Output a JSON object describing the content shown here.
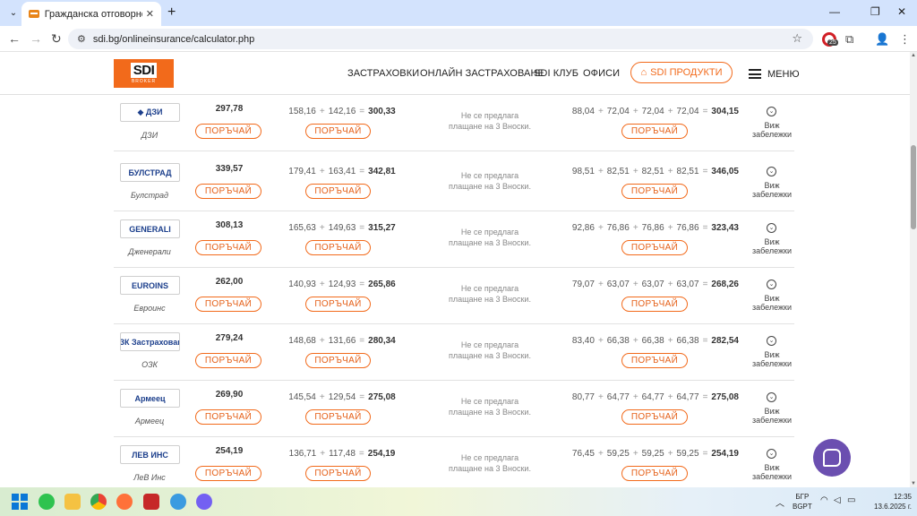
{
  "browser": {
    "tab_title": "Гражданска отговорност - Це",
    "url": "sdi.bg/onlineinsurance/calculator.php",
    "extension_badge": "25",
    "icons": [
      "tab-list-icon",
      "close-icon",
      "plus-icon",
      "minimize-icon",
      "restore-icon",
      "back-icon",
      "forward-icon",
      "reload-icon",
      "site-info-icon",
      "star-icon",
      "puzzle-icon",
      "profile-icon",
      "more-icon"
    ]
  },
  "header": {
    "logo_text": "SDI",
    "logo_sub": "BROKER",
    "nav": [
      "ЗАСТРАХОВКИ",
      "ОНЛАЙН ЗАСТРАХОВАНЕ",
      "SDI КЛУБ",
      "ОФИСИ"
    ],
    "products_label": "SDI ПРОДУКТИ",
    "menu_label": "МЕНЮ",
    "brand_color": "#f26a1b"
  },
  "order_label": "ПОРЪЧАЙ",
  "remark_line1": "Виж",
  "remark_line2": "забележки",
  "rows": [
    {
      "logo": "◆ ДЗИ",
      "name": "ДЗИ",
      "price": "297,78",
      "two": [
        "158,16",
        "142,16",
        "300,33"
      ],
      "note1": "Не се предлага",
      "note2": "плащане на 3 Вноски.",
      "four": [
        "88,04",
        "72,04",
        "72,04",
        "72,04",
        "304,15"
      ]
    },
    {
      "logo": "БУЛСТРАД",
      "name": "Булстрад",
      "price": "339,57",
      "two": [
        "179,41",
        "163,41",
        "342,81"
      ],
      "note1": "Не се предлага",
      "note2": "плащане на 3 Вноски.",
      "four": [
        "98,51",
        "82,51",
        "82,51",
        "82,51",
        "346,05"
      ]
    },
    {
      "logo": "GENERALI",
      "name": "Дженерали",
      "price": "308,13",
      "two": [
        "165,63",
        "149,63",
        "315,27"
      ],
      "note1": "Не се предлага",
      "note2": "плащане на 3 Вноски.",
      "four": [
        "92,86",
        "76,86",
        "76,86",
        "76,86",
        "323,43"
      ]
    },
    {
      "logo": "EUROINS",
      "name": "Евроинс",
      "price": "262,00",
      "two": [
        "140,93",
        "124,93",
        "265,86"
      ],
      "note1": "Не се предлага",
      "note2": "плащане на 3 Вноски.",
      "four": [
        "79,07",
        "63,07",
        "63,07",
        "63,07",
        "268,26"
      ]
    },
    {
      "logo": "ОЗК Застраховане",
      "name": "ОЗК",
      "price": "279,24",
      "two": [
        "148,68",
        "131,66",
        "280,34"
      ],
      "note1": "Не се предлага",
      "note2": "плащане на 3 Вноски.",
      "four": [
        "83,40",
        "66,38",
        "66,38",
        "66,38",
        "282,54"
      ]
    },
    {
      "logo": "Армеец",
      "name": "Армеец",
      "price": "269,90",
      "two": [
        "145,54",
        "129,54",
        "275,08"
      ],
      "note1": "Не се предлага",
      "note2": "плащане на 3 Вноски.",
      "four": [
        "80,77",
        "64,77",
        "64,77",
        "64,77",
        "275,08"
      ]
    },
    {
      "logo": "ЛЕВ ИНС",
      "name": "ЛеВ Инс",
      "price": "254,19",
      "two": [
        "136,71",
        "117,48",
        "254,19"
      ],
      "note1": "Не се предлага",
      "note2": "плащане на 3 Вноски.",
      "four": [
        "76,45",
        "59,25",
        "59,25",
        "59,25",
        "254,19"
      ]
    }
  ],
  "taskbar": {
    "lang_line1": "БГР",
    "lang_line2": "BGPT",
    "time": "12:35",
    "date": "13.6.2025 г."
  }
}
